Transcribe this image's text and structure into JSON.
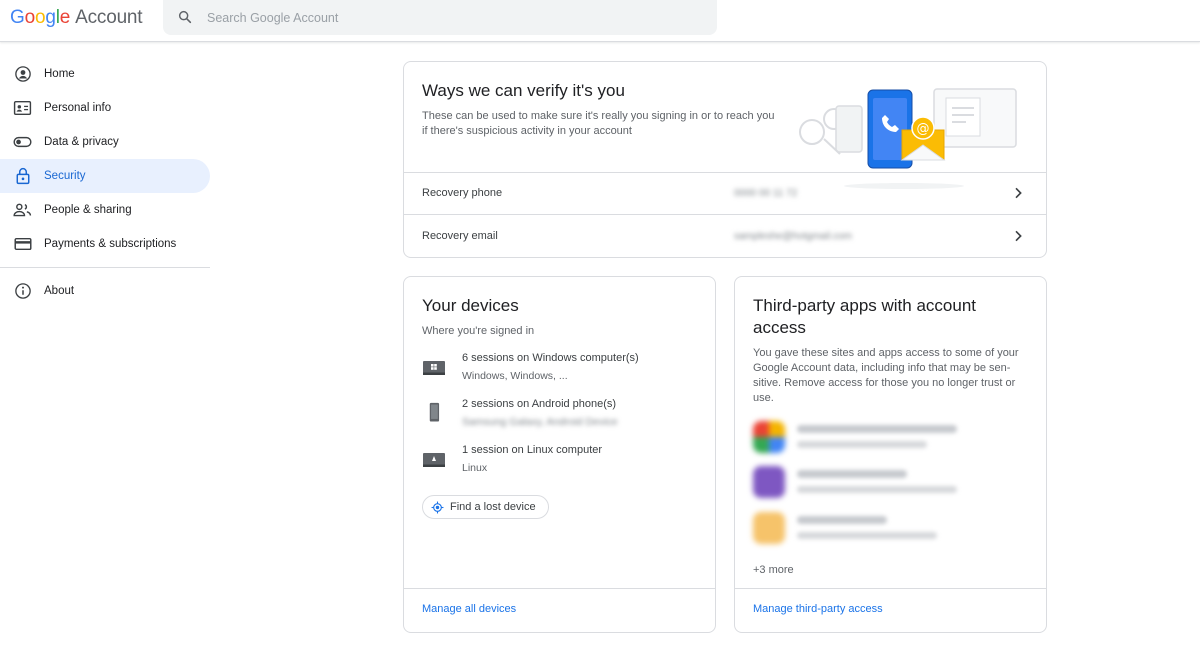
{
  "header": {
    "logo_letters": [
      "G",
      "o",
      "o",
      "g",
      "l",
      "e"
    ],
    "logo_suffix": "Account",
    "search_placeholder": "Search Google Account"
  },
  "sidebar": {
    "items": [
      {
        "label": "Home",
        "icon": "home-icon",
        "active": false
      },
      {
        "label": "Personal info",
        "icon": "id-card-icon",
        "active": false
      },
      {
        "label": "Data & privacy",
        "icon": "toggle-icon",
        "active": false
      },
      {
        "label": "Security",
        "icon": "lock-icon",
        "active": true
      },
      {
        "label": "People & sharing",
        "icon": "people-icon",
        "active": false
      },
      {
        "label": "Payments & subscriptions",
        "icon": "credit-card-icon",
        "active": false
      }
    ],
    "about": {
      "label": "About",
      "icon": "info-icon"
    }
  },
  "verify": {
    "title": "Ways we can verify it's you",
    "description": "These can be used to make sure it's really you signing in or to reach you if there's suspicious activity in your account",
    "rows": [
      {
        "label": "Recovery phone",
        "value": "0000 00 11 72"
      },
      {
        "label": "Recovery email",
        "value": "sampleshe@hotgmail.com"
      }
    ]
  },
  "devices": {
    "title": "Your devices",
    "subtitle": "Where you're signed in",
    "items": [
      {
        "title": "6 sessions on Windows computer(s)",
        "sub": "Windows, Windows, ...",
        "icon": "windows-laptop-icon",
        "blurred": false
      },
      {
        "title": "2 sessions on Android phone(s)",
        "sub": "Samsung Galaxy, Android Device",
        "icon": "android-phone-icon",
        "blurred": true
      },
      {
        "title": "1 session on Linux computer",
        "sub": "Linux",
        "icon": "linux-laptop-icon",
        "blurred": false
      }
    ],
    "find_label": "Find a lost device",
    "manage_label": "Manage all devices"
  },
  "thirdparty": {
    "title": "Third-party apps with account access",
    "description": "You gave these sites and apps access to some of your Google Account data, including info that may be sen-sitive. Remove access for those you no longer trust or use.",
    "apps": [
      {
        "color": "#f4b400"
      },
      {
        "color": "#7e57c2"
      },
      {
        "color": "#f6c36a"
      }
    ],
    "more_label": "+3 more",
    "manage_label": "Manage third-party access"
  },
  "colors": {
    "accent": "#1a73e8",
    "active_bg": "#e8f0fe",
    "active_text": "#1967d2",
    "border": "#dadce0"
  }
}
